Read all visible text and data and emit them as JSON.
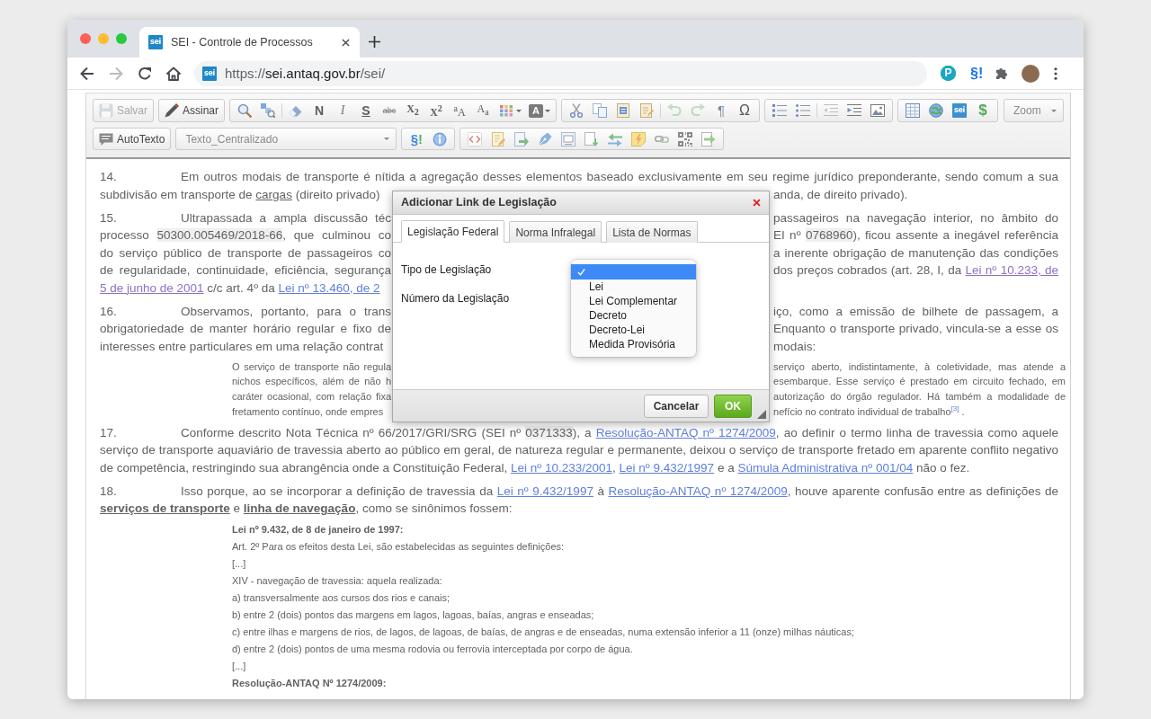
{
  "browser": {
    "tab": {
      "logo": "sei",
      "title": "SEI - Controle de Processos"
    },
    "back_button": {
      "disabled": false
    },
    "forward_button": {
      "disabled": true
    },
    "address_bar": {
      "logo": "sei",
      "url_scheme": "https://",
      "url_host": "sei.antaq.gov.br",
      "url_path": "/sei/"
    },
    "extensions": [
      {
        "kind": "badge",
        "label": "P"
      },
      {
        "kind": "glyph",
        "label": "§!"
      }
    ]
  },
  "editor_toolbar": {
    "save_button": {
      "label": "Salvar",
      "disabled": true
    },
    "sign_button": {
      "label": "Assinar",
      "disabled": false
    },
    "format_glyphs": [
      "N",
      "I",
      "S",
      "abc",
      "X$_{2}$",
      "X$^{2}$",
      "$^{a}$A",
      "A$_{a}$"
    ],
    "text_color_glyph": "A",
    "undo_button": {
      "disabled": true
    },
    "redo_button": {
      "disabled": true
    },
    "symbol_glyphs": [
      "¶",
      "Ω"
    ],
    "logo": "sei",
    "currency_glyph": "$",
    "zoom_select": {
      "value": "Zoom"
    },
    "autotext_button": {
      "label": "AutoTexto"
    },
    "style_select": {
      "value": "Texto_Centralizado"
    },
    "section_glyph": "§!"
  },
  "document": {
    "blocks": [
      {
        "kind": "covered_paragraph",
        "number": "14.",
        "lines": [
          {
            "left": [
              {
                "kind": "plain",
                "text": "Em outros modais de transporte é nítida a agregação desses elementos baseado exclusivamente em seu regime jurídico preponderante, sendo comum a sua"
              }
            ]
          },
          {
            "left": [
              {
                "kind": "plain",
                "text": "subdivisão em transporte de "
              },
              {
                "kind": "underlined",
                "text": "cargas"
              },
              {
                "kind": "plain",
                "text": " (direito privado)"
              }
            ],
            "right": [
              {
                "kind": "plain",
                "text": "anda, de direito privado)."
              }
            ]
          }
        ]
      },
      {
        "kind": "covered_paragraph",
        "number": "15.",
        "lines": [
          {
            "left": [
              {
                "kind": "plain",
                "text": "Ultrapassada a ampla discussão téc"
              }
            ],
            "right": [
              {
                "kind": "plain",
                "text": "passageiros na navegação interior, no âmbito do"
              }
            ]
          },
          {
            "left": [
              {
                "kind": "plain",
                "text": "processo "
              },
              {
                "kind": "reference",
                "text": "50300.005469/2018-66"
              },
              {
                "kind": "plain",
                "text": ", que culminou co"
              }
            ],
            "right": [
              {
                "kind": "plain",
                "text": "EI nº "
              },
              {
                "kind": "reference",
                "text": "0768960"
              },
              {
                "kind": "plain",
                "text": "), ficou assente a inegável referência"
              }
            ]
          },
          {
            "left": [
              {
                "kind": "plain",
                "text": "do serviço público de transporte de passageiros co"
              }
            ],
            "right": [
              {
                "kind": "plain",
                "text": "a inerente obrigação de manutenção das condições"
              }
            ]
          },
          {
            "left": [
              {
                "kind": "plain",
                "text": "de regularidade, continuidade, eficiência, segurança"
              }
            ],
            "right": [
              {
                "kind": "plain",
                "text": "dos preços cobrados (art. 28, I, da "
              },
              {
                "kind": "visited_link",
                "text": "Lei nº 10.233, de"
              }
            ]
          },
          {
            "left": [
              {
                "kind": "visited_link",
                "text": "5 de junho de 2001"
              },
              {
                "kind": "plain",
                "text": " c/c art. 4º da "
              },
              {
                "kind": "link",
                "text": "Lei nº 13.460, de 2"
              }
            ]
          }
        ]
      },
      {
        "kind": "covered_paragraph",
        "number": "16.",
        "lines": [
          {
            "left": [
              {
                "kind": "plain",
                "text": "Observamos, portanto, para o trans"
              }
            ],
            "right": [
              {
                "kind": "plain",
                "text": "iço, como a emissão de bilhete de passagem, a"
              }
            ]
          },
          {
            "left": [
              {
                "kind": "plain",
                "text": "obrigatoriedade de manter horário regular e fixo de"
              }
            ],
            "right": [
              {
                "kind": "plain",
                "text": "Enquanto o transporte privado, vincula-se a esse os"
              }
            ]
          },
          {
            "left": [
              {
                "kind": "plain",
                "text": "interesses entre particulares em uma relação contrat"
              }
            ],
            "right": [
              {
                "kind": "plain",
                "text": "modais:"
              }
            ]
          }
        ]
      },
      {
        "kind": "covered_quote",
        "lines": [
          {
            "left": [
              {
                "kind": "plain",
                "text": "O serviço de transporte não regula"
              }
            ],
            "right": [
              {
                "kind": "plain",
                "text": "serviço aberto, indistintamente, à coletividade, mas atende a"
              }
            ]
          },
          {
            "left": [
              {
                "kind": "plain",
                "text": "nichos específicos, além de não h"
              }
            ],
            "right": [
              {
                "kind": "plain",
                "text": "esembarque. Esse serviço é prestado em circuito fechado, em"
              }
            ]
          },
          {
            "left": [
              {
                "kind": "plain",
                "text": "caráter ocasional, com relação fixa"
              }
            ],
            "right": [
              {
                "kind": "plain",
                "text": "autorização do órgão regulador. Há também a modalidade de"
              }
            ]
          },
          {
            "left": [
              {
                "kind": "plain",
                "text": "fretamento contínuo, onde empres"
              }
            ],
            "right": [
              {
                "kind": "plain",
                "text": "nefício no contrato individual de trabalho"
              },
              {
                "kind": "note",
                "text": "[3]"
              },
              {
                "kind": "plain",
                "text": " ."
              }
            ]
          }
        ]
      },
      {
        "kind": "paragraph",
        "number": "17.",
        "segments": [
          {
            "kind": "plain",
            "text": "Conforme descrito Nota Técnica nº 66/2017/GRI/SRG (SEI nº "
          },
          {
            "kind": "reference",
            "text": "0371333"
          },
          {
            "kind": "plain",
            "text": "), a "
          },
          {
            "kind": "link",
            "text": "Resolução-ANTAQ nº 1274/2009"
          },
          {
            "kind": "plain",
            "text": ", ao definir o termo linha de travessia como aquele serviço de transporte aquaviário de travessia aberto ao público em geral, de natureza regular e permanente, deixou o serviço de transporte fretado em aparente conflito negativo de competência, restringindo sua abrangência onde a Constituição Federal, "
          },
          {
            "kind": "link",
            "text": "Lei nº 10.233/2001"
          },
          {
            "kind": "plain",
            "text": ", "
          },
          {
            "kind": "link",
            "text": "Lei nº 9.432/1997"
          },
          {
            "kind": "plain",
            "text": " e a "
          },
          {
            "kind": "link",
            "text": "Súmula Administrativa nº 001/04"
          },
          {
            "kind": "plain",
            "text": " não o fez."
          }
        ]
      },
      {
        "kind": "paragraph",
        "number": "18.",
        "segments": [
          {
            "kind": "plain",
            "text": "Isso porque, ao se incorporar a definição de travessia da "
          },
          {
            "kind": "link",
            "text": "Lei nº 9.432/1997"
          },
          {
            "kind": "plain",
            "text": " à "
          },
          {
            "kind": "link",
            "text": "Resolução-ANTAQ nº 1274/2009"
          },
          {
            "kind": "plain",
            "text": ", houve aparente confusão entre as definições de "
          },
          {
            "kind": "strong",
            "text": "serviços de transporte"
          },
          {
            "kind": "plain",
            "text": " e "
          },
          {
            "kind": "strong",
            "text": "linha de navegação"
          },
          {
            "kind": "plain",
            "text": ", como se sinônimos fossem:"
          }
        ]
      },
      {
        "kind": "quote",
        "lines": [
          {
            "kind": "heading",
            "text": "Lei nº 9.432, de 8 de janeiro de 1997:"
          },
          {
            "kind": "line",
            "text": "Art. 2º Para os efeitos desta Lei, são estabelecidas as seguintes definições:"
          },
          {
            "kind": "line",
            "text": "[...]"
          },
          {
            "kind": "line",
            "text": "XIV - navegação de travessia: aquela realizada:"
          },
          {
            "kind": "line",
            "text": "a) transversalmente aos cursos dos rios e canais;"
          },
          {
            "kind": "line",
            "text": "b) entre 2 (dois) pontos das margens em lagos, lagoas, baías, angras e enseadas;"
          },
          {
            "kind": "line",
            "text": "c) entre ilhas e margens de rios, de lagos, de lagoas, de baías, de angras e de enseadas, numa extensão inferior a 11 (onze) milhas náuticas;"
          },
          {
            "kind": "line",
            "text": "d) entre 2 (dois) pontos de uma mesma rodovia ou ferrovia interceptada por corpo de água."
          },
          {
            "kind": "line",
            "text": "[...]"
          },
          {
            "kind": "heading",
            "text": "Resolução-ANTAQ Nº 1274/2009:"
          }
        ]
      }
    ]
  },
  "dialog": {
    "title": "Adicionar Link de Legislação",
    "tabs": [
      {
        "label": "Legislação Federal",
        "selected": true
      },
      {
        "label": "Norma Infralegal",
        "selected": false
      },
      {
        "label": "Lista de Normas",
        "selected": false
      }
    ],
    "fields": [
      {
        "label": "Tipo de Legislação",
        "dropdown": {
          "options": [
            {
              "selected": true
            },
            {
              "label": "Lei",
              "selected": false
            },
            {
              "label": "Lei Complementar",
              "selected": false
            },
            {
              "label": "Decreto",
              "selected": false
            },
            {
              "label": "Decreto-Lei",
              "selected": false
            },
            {
              "label": "Medida Provisória",
              "selected": false
            }
          ]
        }
      },
      {
        "label": "Número da Legislação"
      }
    ],
    "buttons": [
      {
        "kind": "secondary",
        "label": "Cancelar"
      },
      {
        "kind": "primary",
        "label": "OK"
      }
    ]
  }
}
